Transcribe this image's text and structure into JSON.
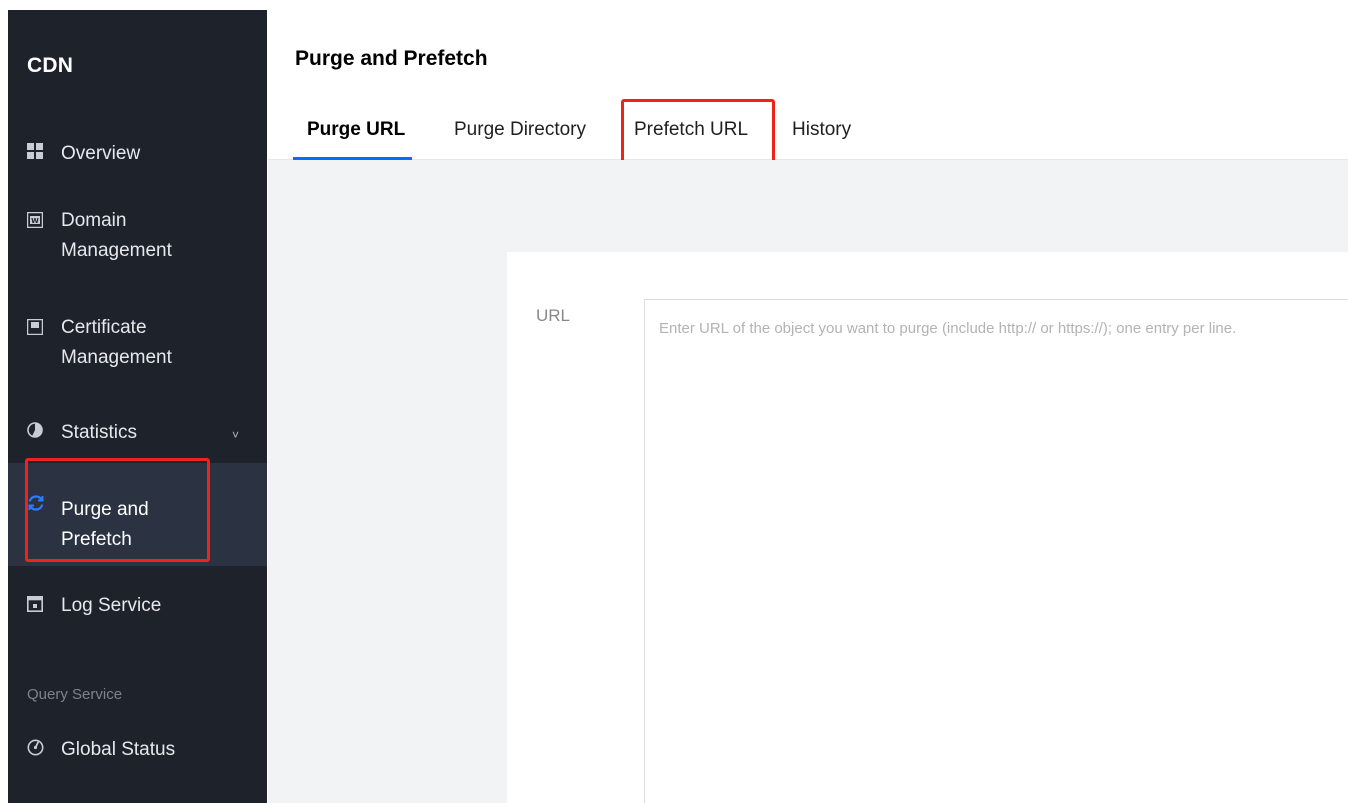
{
  "sidebar": {
    "brand": "CDN",
    "items": [
      {
        "label": "Overview",
        "icon": "grid-icon"
      },
      {
        "label": "Domain\nManagement",
        "icon": "domain-icon"
      },
      {
        "label": "Certificate\nManagement",
        "icon": "certificate-icon"
      },
      {
        "label": "Statistics",
        "icon": "pie-chart-icon",
        "chevron": "˅"
      },
      {
        "label": "Purge and\nPrefetch",
        "icon": "refresh-icon",
        "active": true
      },
      {
        "label": "Log Service",
        "icon": "log-icon"
      }
    ],
    "section_label": "Query Service",
    "section_items": [
      {
        "label": "Global Status",
        "icon": "gauge-icon"
      }
    ]
  },
  "header": {
    "title": "Purge and Prefetch"
  },
  "tabs": [
    {
      "label": "Purge URL",
      "active": true
    },
    {
      "label": "Purge Directory",
      "active": false
    },
    {
      "label": "Prefetch URL",
      "active": false
    },
    {
      "label": "History",
      "active": false
    }
  ],
  "form": {
    "url_label": "URL",
    "url_placeholder": "Enter URL of the object you want to purge (include http:// or https://); one entry per line.",
    "url_value": ""
  },
  "colors": {
    "sidebar_bg": "#1e222b",
    "active_item_bg": "#2b3342",
    "accent": "#006eff",
    "highlight": "#f0231c"
  }
}
